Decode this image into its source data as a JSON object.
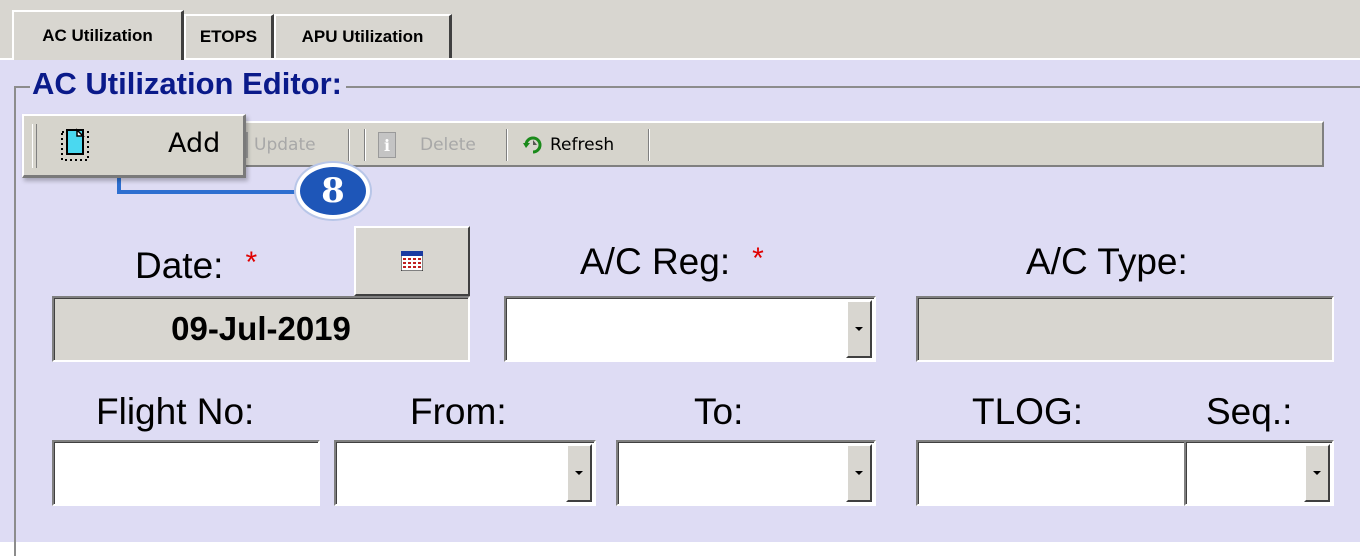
{
  "tabs": [
    {
      "label": "AC Utilization",
      "active": true
    },
    {
      "label": "ETOPS",
      "active": false
    },
    {
      "label": "APU Utilization",
      "active": false
    }
  ],
  "editor": {
    "title": "AC Utilization Editor:"
  },
  "toolbar": {
    "add_label": "Add",
    "update_label": "Update",
    "delete_label": "Delete",
    "refresh_label": "Refresh"
  },
  "callout": {
    "step": "8"
  },
  "form": {
    "date_label": "Date:",
    "date_value": "09-Jul-2019",
    "required_mark": "*",
    "ac_reg_label": "A/C Reg:",
    "ac_reg_value": "",
    "ac_type_label": "A/C Type:",
    "ac_type_value": "",
    "flight_no_label": "Flight No:",
    "flight_no_value": "",
    "from_label": "From:",
    "from_value": "",
    "to_label": "To:",
    "to_value": "",
    "tlog_label": "TLOG:",
    "tlog_value": "",
    "seq_label": "Seq.:",
    "seq_value": ""
  },
  "colors": {
    "panel_bg": "#dedcf4",
    "title_color": "#0a1a8a",
    "required_color": "#e00000",
    "callout_blue": "#1e56b8"
  },
  "icons": {
    "add": "add-record-icon",
    "update": "update-icon",
    "delete": "delete-icon",
    "refresh": "refresh-icon",
    "calendar": "calendar-icon",
    "dropdown": "chevron-down-icon"
  }
}
